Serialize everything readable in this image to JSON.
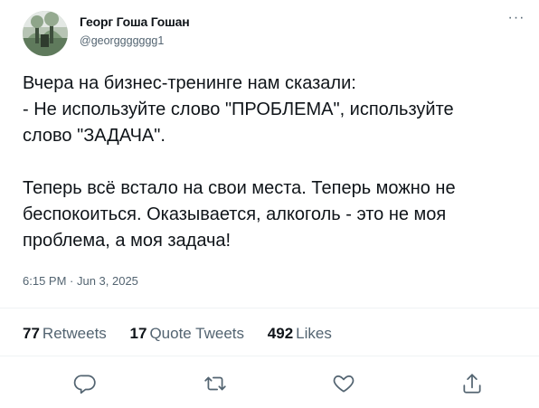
{
  "author": {
    "display_name": "Георг Гоша Гошан",
    "handle": "@georggggggg1"
  },
  "tweet": {
    "lines": [
      "Вчера на бизнес-тренинге нам сказали:",
      "- Не используйте слово \"ПРОБЛЕМА\", используйте",
      "слово \"ЗАДАЧА\".",
      "",
      "Теперь всё встало на свои места. Теперь можно не",
      "беспокоиться. Оказывается, алкоголь - это не моя",
      "проблема, а моя задача!"
    ],
    "timestamp": "6:15 PM · Jun 3, 2025"
  },
  "stats": {
    "retweets": {
      "count": "77",
      "label": "Retweets"
    },
    "quote_tweets": {
      "count": "17",
      "label": "Quote Tweets"
    },
    "likes": {
      "count": "492",
      "label": "Likes"
    }
  },
  "actions": {
    "more_icon": "more-horizontal-icon",
    "reply_icon": "reply-icon",
    "retweet_icon": "retweet-icon",
    "like_icon": "heart-icon",
    "share_icon": "share-icon"
  },
  "colors": {
    "text": "#0f1419",
    "secondary": "#536471",
    "divider": "#eff3f4"
  }
}
